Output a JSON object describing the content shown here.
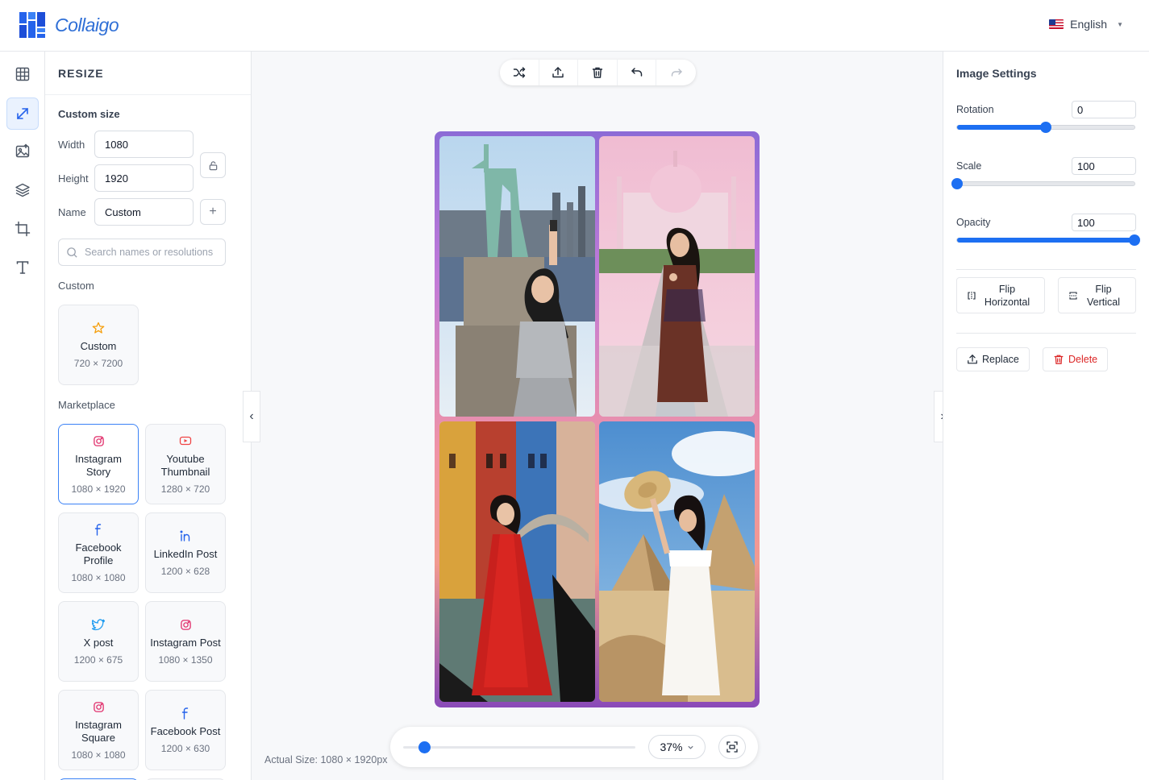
{
  "app": {
    "name": "Collaigo",
    "language": "English"
  },
  "colors": {
    "accent": "#1d6ff2",
    "danger": "#dc2626"
  },
  "rail": [
    {
      "name": "layout-icon"
    },
    {
      "name": "resize-icon",
      "active": true
    },
    {
      "name": "image-icon"
    },
    {
      "name": "layers-icon"
    },
    {
      "name": "crop-icon"
    },
    {
      "name": "text-icon"
    }
  ],
  "resize": {
    "title": "RESIZE",
    "custom_size_label": "Custom size",
    "width_label": "Width",
    "width_value": "1080",
    "height_label": "Height",
    "height_value": "1920",
    "name_label": "Name",
    "name_value": "Custom",
    "add_symbol": "+",
    "search_placeholder": "Search names or resolutions",
    "custom_section": "Custom",
    "custom_card": {
      "name": "Custom",
      "size": "720 × 7200",
      "icon": "star-icon"
    },
    "marketplace_section": "Marketplace",
    "presets": [
      {
        "name": "Instagram Story",
        "size": "1080 × 1920",
        "icon": "instagram-icon",
        "selected": true
      },
      {
        "name": "Youtube Thumbnail",
        "size": "1280 × 720",
        "icon": "youtube-icon"
      },
      {
        "name": "Facebook Profile",
        "size": "1080 × 1080",
        "icon": "facebook-icon"
      },
      {
        "name": "LinkedIn Post",
        "size": "1200 × 628",
        "icon": "linkedin-icon"
      },
      {
        "name": "X post",
        "size": "1200 × 675",
        "icon": "twitter-icon"
      },
      {
        "name": "Instagram Post",
        "size": "1080 × 1350",
        "icon": "instagram-icon"
      },
      {
        "name": "Instagram Square",
        "size": "1080 × 1080",
        "icon": "instagram-icon"
      },
      {
        "name": "Facebook Post",
        "size": "1200 × 630",
        "icon": "facebook-icon"
      }
    ]
  },
  "canvas": {
    "zoom_percent": "37%",
    "zoom_level": 0.09,
    "actual_size": "Actual Size: 1080 × 1920px (3"
  },
  "image_settings": {
    "title": "Image Settings",
    "rotation_label": "Rotation",
    "rotation_value": "0",
    "rotation_level": 0.5,
    "scale_label": "Scale",
    "scale_value": "100",
    "scale_level": 0.0,
    "opacity_label": "Opacity",
    "opacity_value": "100",
    "opacity_level": 1.0,
    "flip_horizontal_label": "Flip Horizontal",
    "flip_vertical_label": "Flip Vertical",
    "replace_label": "Replace",
    "delete_label": "Delete"
  }
}
